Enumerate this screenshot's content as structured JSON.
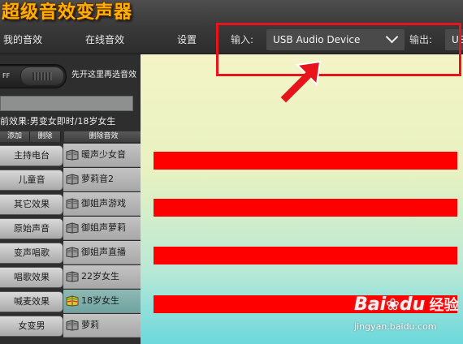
{
  "app": {
    "title": "超级音效变声器"
  },
  "tabs": [
    {
      "label": "我的音效"
    },
    {
      "label": "在线音效"
    },
    {
      "label": "设置"
    }
  ],
  "input": {
    "label": "输入:",
    "device": "USB Audio Device"
  },
  "output": {
    "label": "输出:",
    "device": "US"
  },
  "toggle": {
    "state_label": "FF"
  },
  "hint": "先开这里再选音效",
  "current_effect": "前效果:男变女即时/18岁女生",
  "columns": {
    "add": "添加",
    "delete": "删除",
    "delete_effect": "删除音效"
  },
  "rows": [
    {
      "category": "主持电台",
      "effect": "暖声少女音",
      "selected": false
    },
    {
      "category": "儿童音",
      "effect": "萝莉音2",
      "selected": false
    },
    {
      "category": "其它效果",
      "effect": "御姐声游戏",
      "selected": false
    },
    {
      "category": "原始声音",
      "effect": "御姐声萝莉",
      "selected": false
    },
    {
      "category": "变声唱歌",
      "effect": "御姐声直播",
      "selected": false
    },
    {
      "category": "唱歌效果",
      "effect": "22岁女生",
      "selected": false
    },
    {
      "category": "喊麦效果",
      "effect": "18岁女生",
      "selected": true
    },
    {
      "category": "女变男",
      "effect": "萝莉",
      "selected": false
    }
  ],
  "watermark": {
    "brand": "Bai",
    "brand2": "du",
    "product": "经验",
    "url": "jingyan.baidu.com"
  },
  "colors": {
    "highlight": "#e8141b",
    "bars": "#ff0000",
    "title": "#ffb000"
  }
}
